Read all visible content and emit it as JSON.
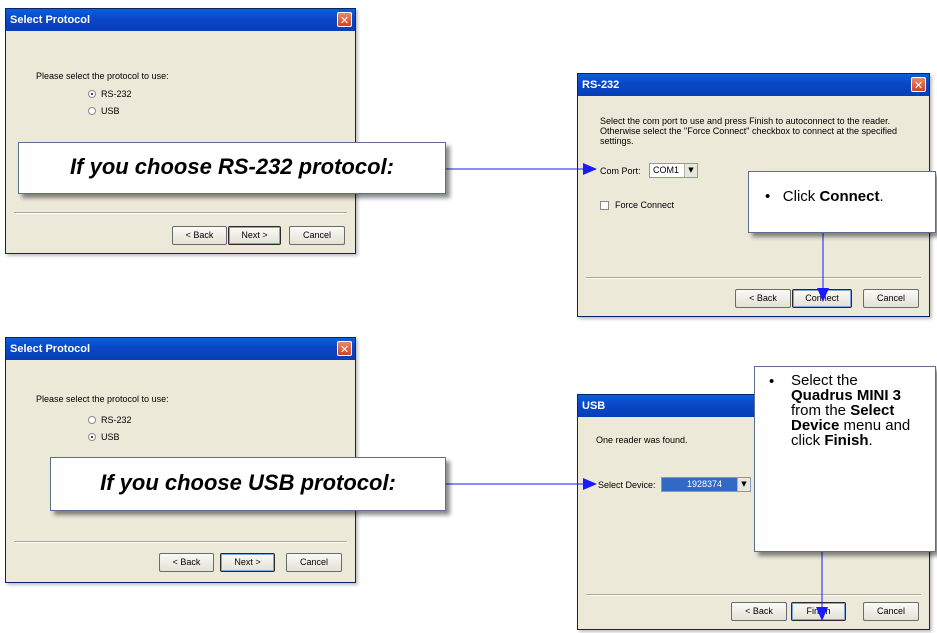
{
  "dialog_protocol_top": {
    "title": "Select Protocol",
    "prompt": "Please select the protocol to use:",
    "options": [
      "RS-232",
      "USB"
    ],
    "selected": "RS-232",
    "buttons": {
      "back": "< Back",
      "next": "Next >",
      "cancel": "Cancel"
    }
  },
  "dialog_protocol_bottom": {
    "title": "Select Protocol",
    "prompt": "Please select the protocol to use:",
    "options": [
      "RS-232",
      "USB"
    ],
    "selected": "USB",
    "buttons": {
      "back": "< Back",
      "next": "Next >",
      "cancel": "Cancel"
    }
  },
  "dialog_rs232": {
    "title": "RS-232",
    "instructions": "Select the com port to use and press Finish to autoconnect to the reader. Otherwise select the \"Force Connect\" checkbox to connect at the specified settings.",
    "com_port_label": "Com Port:",
    "com_port_value": "COM1",
    "force_connect_label": "Force Connect",
    "buttons": {
      "back": "< Back",
      "connect": "Connect",
      "cancel": "Cancel"
    }
  },
  "dialog_usb": {
    "title": "USB",
    "found_text": "One reader was found.",
    "select_device_label": "Select Device:",
    "select_device_value": "1928374",
    "buttons": {
      "back": "< Back",
      "finish": "Finish",
      "cancel": "Cancel"
    }
  },
  "callouts": {
    "rs232": "If you choose RS-232 protocol:",
    "usb": "If you choose USB protocol:"
  },
  "notes": {
    "rs232_prefix": "Click ",
    "rs232_bold": "Connect",
    "rs232_suffix": ".",
    "usb_t1": "Select the ",
    "usb_b1": "Quadrus MINI 3",
    "usb_t2": " from the ",
    "usb_b2": "Select Device",
    "usb_t3": " menu and click ",
    "usb_b3": "Finish",
    "usb_t4": "."
  },
  "colors": {
    "arrow": "#1a1aff",
    "titlebar": "#0a47c8",
    "dialog_bg": "#ece9d8"
  }
}
